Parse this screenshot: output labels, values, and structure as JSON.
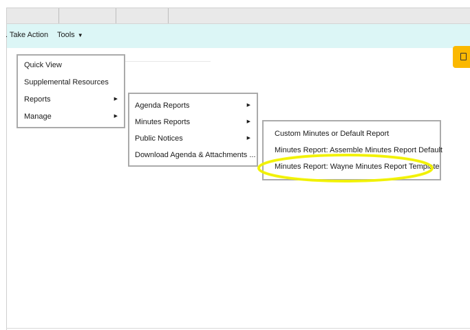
{
  "toolbar": {
    "take_action": ". Take Action",
    "tools": "Tools",
    "tools_arrow": "▼"
  },
  "menu_level1": [
    {
      "label": "Quick View",
      "arrow": ""
    },
    {
      "label": "Supplemental Resources",
      "arrow": ""
    },
    {
      "label": "Reports",
      "arrow": "▶"
    },
    {
      "label": "Manage",
      "arrow": "▶"
    }
  ],
  "menu_level2": [
    {
      "label": "Agenda Reports",
      "arrow": "▶"
    },
    {
      "label": "Minutes Reports",
      "arrow": "▶"
    },
    {
      "label": "Public Notices",
      "arrow": "▶"
    },
    {
      "label": "Download Agenda & Attachments ...",
      "arrow": ""
    }
  ],
  "menu_level3": [
    {
      "label": "Custom Minutes or Default Report"
    },
    {
      "label": "Minutes Report: Assemble Minutes Report Default"
    },
    {
      "label": "Minutes Report: Wayne Minutes Report Template"
    }
  ],
  "highlight": {
    "color": "#f4f400",
    "target": "Minutes Report: Wayne Minutes Report Template"
  },
  "colors": {
    "toolbar_bg": "#dcf6f6",
    "tab_bg": "#e9e9e9",
    "menu_border": "#aaaaaa",
    "accent_button": "#fbb800"
  }
}
